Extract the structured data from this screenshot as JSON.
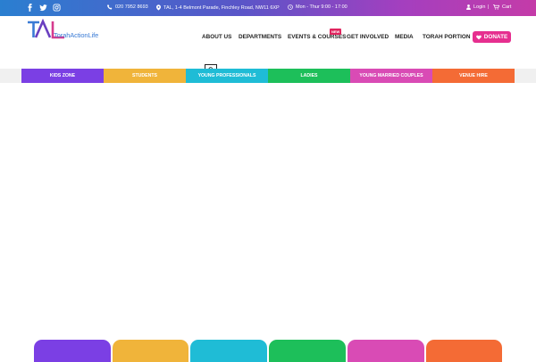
{
  "topbar": {
    "social_icons": [
      "facebook-icon",
      "twitter-icon",
      "instagram-icon"
    ],
    "phone": "020 7952 8693",
    "address": "TAL, 1-4 Belmont Parade, Finchley Road, NW11 6XP",
    "hours": "Mon - Thur 9:00 - 17:00",
    "login": "Login",
    "separator": "|",
    "cart": "Cart"
  },
  "logo": {
    "mark": "TAL",
    "tagline": "TorahActionLife"
  },
  "nav": {
    "items": [
      {
        "label": "ABOUT US"
      },
      {
        "label": "DEPARTMENTS"
      },
      {
        "label": "EVENTS & COURSES",
        "badge": "NEW"
      },
      {
        "label": "GET INVOLVED"
      },
      {
        "label": "MEDIA"
      },
      {
        "label": "TORAH PORTION"
      }
    ],
    "donate": "DONATE"
  },
  "categories": [
    {
      "label": "KIDS ZONE",
      "color": "#7b3fe4"
    },
    {
      "label": "STUDENTS",
      "color": "#f0b43a"
    },
    {
      "label": "YOUNG PROFESSIONALS",
      "color": "#1fbcd6"
    },
    {
      "label": "LADIES",
      "color": "#1dbf5a"
    },
    {
      "label": "YOUNG MARRIED COUPLES",
      "color": "#d94bb5"
    },
    {
      "label": "VENUE HIRE",
      "color": "#f46b35"
    }
  ],
  "colors": {
    "accent_pink": "#e62f8f",
    "logo_blue": "#3a7bd5",
    "logo_purple": "#6a3fc0",
    "logo_pink": "#d63a8e"
  }
}
